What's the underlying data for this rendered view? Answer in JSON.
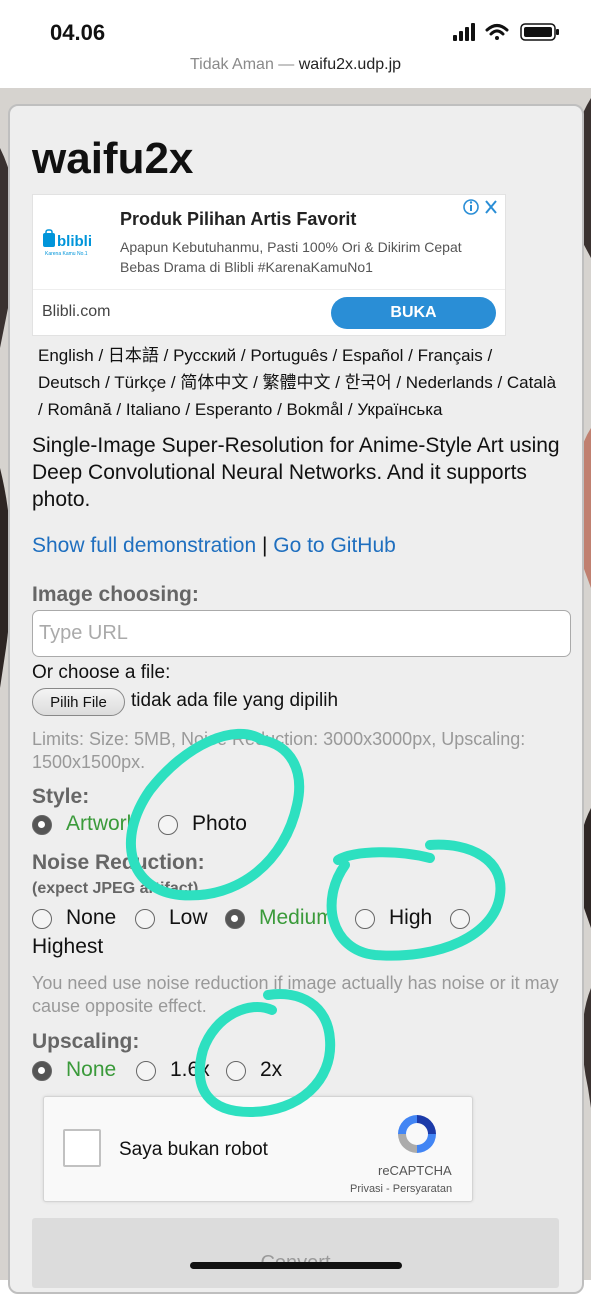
{
  "status": {
    "time": "04.06"
  },
  "browser": {
    "security": "Tidak Aman — ",
    "host": "waifu2x.udp.jp"
  },
  "page": {
    "title": "waifu2x",
    "ad": {
      "headline": "Produk Pilihan Artis Favorit",
      "description": "Apapun Kebutuhanmu, Pasti 100% Ori & Dikirim Cepat Bebas Drama di Blibli #KarenaKamuNo1",
      "domain": "Blibli.com",
      "button": "BUKA",
      "logo_text": "blibli",
      "logo_sub": "Karena Kamu No.1"
    },
    "languages": "English / 日本語 / Русский / Português / Español / Français / Deutsch / Türkçe / 简体中文 / 繁體中文 / 한국어 / Nederlands / Català / Română / Italiano / Esperanto / Bokmål / Українська",
    "description": "Single-Image Super-Resolution for Anime-Style Art using Deep Convolutional Neural Networks. And it supports photo.",
    "links": {
      "demo": "Show full demonstration",
      "separator": " | ",
      "github": "Go to GitHub"
    },
    "image": {
      "label": "Image choosing:",
      "url_placeholder": "Type URL",
      "or_file": "Or choose a file:",
      "file_button": "Pilih File",
      "file_status": "tidak ada file yang dipilih",
      "limits": "Limits: Size: 5MB, Noise Reduction: 3000x3000px, Upscaling: 1500x1500px."
    },
    "style": {
      "label": "Style:",
      "options": [
        "Artwork",
        "Photo"
      ],
      "selected": "Artwork"
    },
    "noise": {
      "label": "Noise Reduction:",
      "sublabel": "(expect JPEG artifact)",
      "options": [
        "None",
        "Low",
        "Medium",
        "High",
        "Highest"
      ],
      "selected": "Medium",
      "note": "You need use noise reduction if image actually has noise or it may cause opposite effect."
    },
    "upscaling": {
      "label": "Upscaling:",
      "options": [
        "None",
        "1.6x",
        "2x"
      ],
      "selected": "None"
    },
    "captcha": {
      "label": "Saya bukan robot",
      "brand": "reCAPTCHA",
      "links": "Privasi - Persyaratan"
    },
    "convert_label": "Convert"
  },
  "colors": {
    "link": "#1f6fbf",
    "selected_option": "#3a9a3a",
    "annotation": "#2de0c0",
    "ad_button": "#2a8ed6"
  }
}
